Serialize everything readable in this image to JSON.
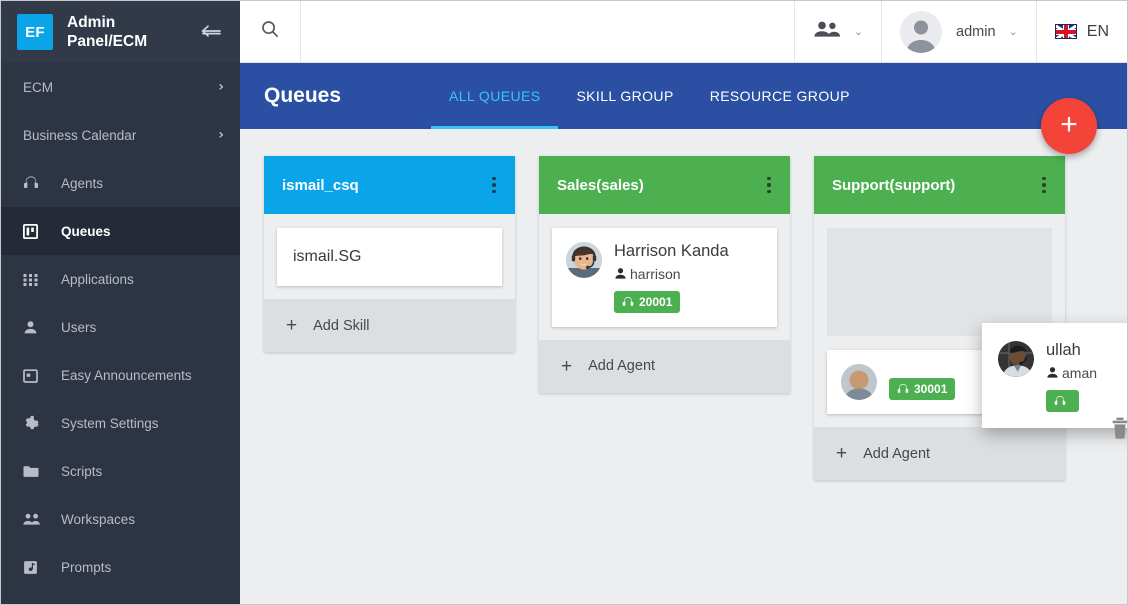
{
  "sidebar": {
    "brand": {
      "logo_text": "EF",
      "title": "Admin\nPanel/ECM",
      "collapse_icon": "collapse-arrow-icon"
    },
    "items": [
      {
        "label": "ECM",
        "icon": "none",
        "chevron": "›",
        "active": false
      },
      {
        "label": "Business Calendar",
        "icon": "none",
        "chevron": "›",
        "active": false
      },
      {
        "label": "Agents",
        "icon": "headset-icon",
        "active": false
      },
      {
        "label": "Queues",
        "icon": "board-icon",
        "active": true
      },
      {
        "label": "Applications",
        "icon": "grid-icon",
        "active": false
      },
      {
        "label": "Users",
        "icon": "person-icon",
        "active": false
      },
      {
        "label": "Easy Announcements",
        "icon": "calendar-icon",
        "active": false
      },
      {
        "label": "System Settings",
        "icon": "gear-icon",
        "active": false
      },
      {
        "label": "Scripts",
        "icon": "folder-icon",
        "active": false
      },
      {
        "label": "Workspaces",
        "icon": "people-icon",
        "active": false
      },
      {
        "label": "Prompts",
        "icon": "music-note-icon",
        "active": false
      }
    ]
  },
  "topbar": {
    "search_icon": "search-icon",
    "people_menu_icon": "people-icon",
    "people_menu_caret": "⌄",
    "admin_label": "admin",
    "admin_caret": "⌄",
    "language": "EN",
    "flag_icon": "uk-flag-icon"
  },
  "page_header": {
    "title": "Queues",
    "tabs": [
      {
        "label": "ALL QUEUES",
        "active": true
      },
      {
        "label": "SKILL GROUP",
        "active": false
      },
      {
        "label": "RESOURCE GROUP",
        "active": false
      }
    ],
    "fab_label": "+",
    "fab_color": "#f4443a",
    "bar_color": "#2b4fa2",
    "active_tab_color": "#38c6f4"
  },
  "board": {
    "queues": [
      {
        "name": "ismail_csq",
        "header_color": "#0aa5e8",
        "kebab_icon": "more-vertical-icon",
        "skills": [
          {
            "name": "ismail.SG"
          }
        ],
        "members": [],
        "placeholder": false,
        "add_label": "Add Skill",
        "add_icon": "plus-icon"
      },
      {
        "name": "Sales(sales)",
        "header_color": "#4caf50",
        "kebab_icon": "more-vertical-icon",
        "skills": [],
        "members": [
          {
            "name": "Harrison Kanda",
            "username": "harrison",
            "extension": "20001",
            "badge_color": "#4caf50",
            "avatar": "agent-photo"
          }
        ],
        "placeholder": false,
        "add_label": "Add Agent",
        "add_icon": "plus-icon"
      },
      {
        "name": "Support(support)",
        "header_color": "#4caf50",
        "kebab_icon": "more-vertical-icon",
        "skills": [],
        "members": [
          {
            "name": "",
            "username": "",
            "extension": "30001",
            "badge_color": "#4caf50",
            "avatar": "agent-photo"
          }
        ],
        "placeholder": true,
        "add_label": "Add Agent",
        "add_icon": "plus-icon"
      }
    ]
  },
  "drag_card": {
    "name": "ullah",
    "username": "aman",
    "extension": "",
    "badge_color": "#4caf50",
    "badge_icon": "headset-icon",
    "avatar": "agent-photo",
    "trash_icon": "trash-icon"
  }
}
